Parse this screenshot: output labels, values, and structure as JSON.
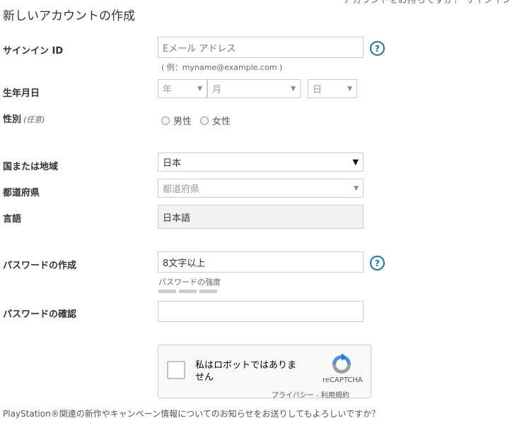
{
  "header": {
    "title": "新しいアカウントの作成",
    "signin_prompt": "アカウントをお持ちですか？ サインイン"
  },
  "signin_id": {
    "label": "サインイン ID",
    "placeholder": "Eメール アドレス",
    "example": "( 例：myname@example.com )",
    "help": "?"
  },
  "birthdate": {
    "label": "生年月日",
    "year": "年",
    "month": "月",
    "day": "日"
  },
  "gender": {
    "label": "性別",
    "optional": "(任意)",
    "options": [
      "男性",
      "女性"
    ]
  },
  "country": {
    "label": "国または地域",
    "value": "日本"
  },
  "prefecture": {
    "label": "都道府県",
    "placeholder": "都道府県"
  },
  "language": {
    "label": "言語",
    "value": "日本語"
  },
  "password": {
    "label": "パスワードの作成",
    "placeholder": "8文字以上",
    "strength_label": "パスワードの強度",
    "help": "?"
  },
  "password_confirm": {
    "label": "パスワードの確認",
    "value": ""
  },
  "captcha": {
    "text": "私はロボットではありません",
    "brand": "reCAPTCHA",
    "links": "プライバシー - 利用規約"
  },
  "footer": {
    "newsletter_question": "PlayStation®関連の新作やキャンペーン情報についてのお知らせをお送りしてもよろしいですか？"
  },
  "colors": {
    "help_icon": "#1a73a8",
    "captcha_blue": "#4a90e2",
    "captcha_gray": "#9e9e9e"
  }
}
